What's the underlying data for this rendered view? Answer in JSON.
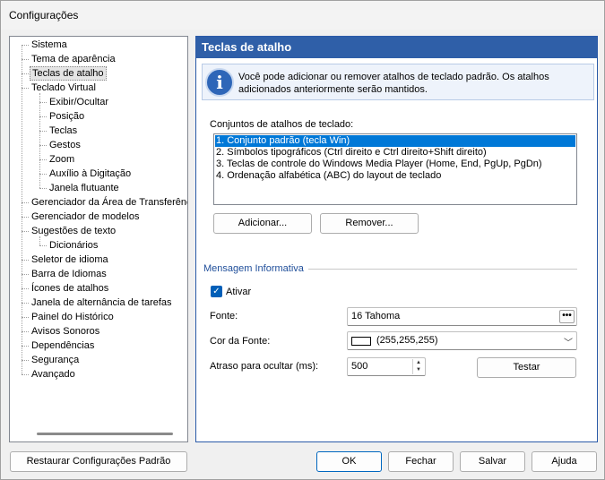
{
  "window": {
    "title": "Configurações"
  },
  "tree": {
    "items": [
      {
        "label": "Sistema",
        "level": 0
      },
      {
        "label": "Tema de aparência",
        "level": 0
      },
      {
        "label": "Teclas de atalho",
        "level": 0,
        "selected": true
      },
      {
        "label": "Teclado Virtual",
        "level": 0
      },
      {
        "label": "Exibir/Ocultar",
        "level": 1
      },
      {
        "label": "Posição",
        "level": 1
      },
      {
        "label": "Teclas",
        "level": 1
      },
      {
        "label": "Gestos",
        "level": 1
      },
      {
        "label": "Zoom",
        "level": 1
      },
      {
        "label": "Auxílio à Digitação",
        "level": 1
      },
      {
        "label": "Janela flutuante",
        "level": 1
      },
      {
        "label": "Gerenciador da Área de Transferênc",
        "level": 0
      },
      {
        "label": "Gerenciador de modelos",
        "level": 0
      },
      {
        "label": "Sugestões de texto",
        "level": 0
      },
      {
        "label": "Dicionários",
        "level": 1
      },
      {
        "label": "Seletor de idioma",
        "level": 0
      },
      {
        "label": "Barra de Idiomas",
        "level": 0
      },
      {
        "label": "Ícones de atalhos",
        "level": 0
      },
      {
        "label": "Janela de alternância de tarefas",
        "level": 0
      },
      {
        "label": "Painel do Histórico",
        "level": 0
      },
      {
        "label": "Avisos Sonoros",
        "level": 0
      },
      {
        "label": "Dependências",
        "level": 0
      },
      {
        "label": "Segurança",
        "level": 0
      },
      {
        "label": "Avançado",
        "level": 0
      }
    ]
  },
  "panel": {
    "header": "Teclas de atalho",
    "info_icon": "info-icon",
    "info_text": "Você pode adicionar ou remover atalhos de teclado padrão. Os atalhos adicionados anteriormente serão mantidos.",
    "sets_label": "Conjuntos de atalhos de teclado:",
    "sets": [
      "1. Conjunto padrão (tecla Win)",
      "2. Símbolos tipográficos (Ctrl direito e Ctrl direito+Shift direito)",
      "3. Teclas de controle do Windows Media Player (Home, End, PgUp, PgDn)",
      "4. Ordenação alfabética (ABC) do layout de teclado"
    ],
    "selected_set_index": 0,
    "add_button": "Adicionar...",
    "remove_button": "Remover...",
    "group_title": "Mensagem Informativa",
    "enable_label": "Ativar",
    "enable_checked": true,
    "font_label": "Fonte:",
    "font_value": "16 Tahoma",
    "font_button": "•••",
    "font_color_label": "Cor da Fonte:",
    "font_color_value": "(255,255,255)",
    "font_color_swatch": "#ffffff",
    "delay_label": "Atraso para ocultar (ms):",
    "delay_value": "500",
    "test_button": "Testar"
  },
  "footer": {
    "restore_button": "Restaurar Configurações Padrão",
    "ok_button": "OK",
    "cancel_button": "Fechar",
    "save_button": "Salvar",
    "help_button": "Ajuda"
  },
  "colors": {
    "header_bg": "#2f5fa8",
    "selection": "#0078d7",
    "group_title": "#1f4e9a"
  }
}
